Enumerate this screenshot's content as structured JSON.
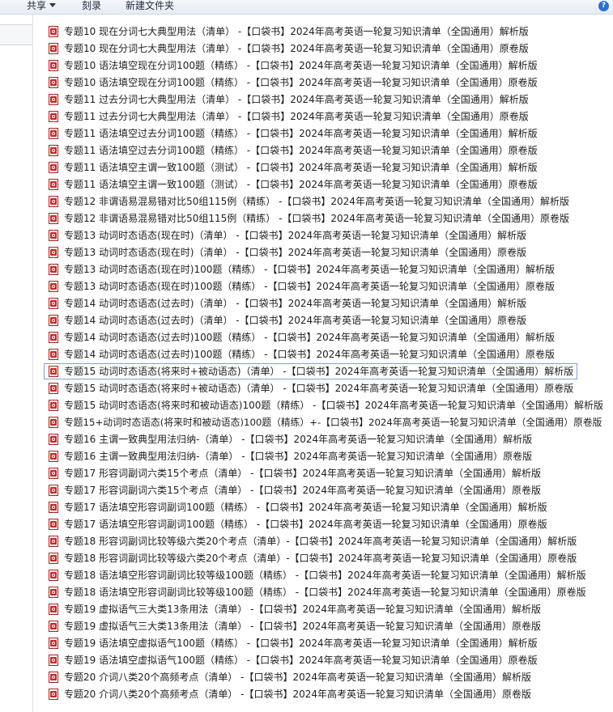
{
  "toolbar": {
    "share_label": "共享",
    "burn_label": "刻录",
    "new_folder_label": "新建文件夹",
    "help_icon": "help-icon"
  },
  "files": [
    "专题10 现在分词七大典型用法（清单） -【口袋书】2024年高考英语一轮复习知识清单（全国通用）解析版",
    "专题10 现在分词七大典型用法（清单） -【口袋书】2024年高考英语一轮复习知识清单（全国通用）原卷版",
    "专题10 语法填空现在分词100题（精练） -【口袋书】2024年高考英语一轮复习知识清单（全国通用）解析版",
    "专题10 语法填空现在分词100题（精练） -【口袋书】2024年高考英语一轮复习知识清单（全国通用）原卷版",
    "专题11 过去分词七大典型用法（清单） -【口袋书】2024年高考英语一轮复习知识清单（全国通用）解析版",
    "专题11 过去分词七大典型用法（清单） -【口袋书】2024年高考英语一轮复习知识清单（全国通用）原卷版",
    "专题11 语法填空过去分词100题（精练） -【口袋书】2024年高考英语一轮复习知识清单（全国通用）解析版",
    "专题11 语法填空过去分词100题（精练） -【口袋书】2024年高考英语一轮复习知识清单（全国通用）原卷版",
    "专题11 语法填空主谓一致100题（测试） -【口袋书】2024年高考英语一轮复习知识清单（全国通用）解析版",
    "专题11 语法填空主谓一致100题（测试） -【口袋书】2024年高考英语一轮复习知识清单（全国通用）原卷版",
    "专题12 非谓语易混易错对比50组115例（精练） -【口袋书】2024年高考英语一轮复习知识清单（全国通用）解析版",
    "专题12 非谓语易混易错对比50组115例（精练） -【口袋书】2024年高考英语一轮复习知识清单（全国通用）原卷版",
    "专题13 动词时态语态(现在时)（清单） -【口袋书】2024年高考英语一轮复习知识清单（全国通用）解析版",
    "专题13 动词时态语态(现在时)（清单） -【口袋书】2024年高考英语一轮复习知识清单（全国通用）原卷版",
    "专题13 动词时态语态(现在时)100题（精练） -【口袋书】2024年高考英语一轮复习知识清单（全国通用）解析版",
    "专题13 动词时态语态(现在时)100题（精练） -【口袋书】2024年高考英语一轮复习知识清单（全国通用）原卷版",
    "专题14 动词时态语态(过去时)（清单） -【口袋书】2024年高考英语一轮复习知识清单（全国通用）解析版",
    "专题14 动词时态语态(过去时)（清单） -【口袋书】2024年高考英语一轮复习知识清单（全国通用）原卷版",
    "专题14 动词时态语态(过去时)100题（精练） -【口袋书】2024年高考英语一轮复习知识清单（全国通用）解析版",
    "专题14 动词时态语态(过去时)100题（精练） -【口袋书】2024年高考英语一轮复习知识清单（全国通用）原卷版",
    "专题15 动词时态语态(将来时+被动语态)（清单） -【口袋书】2024年高考英语一轮复习知识清单（全国通用）解析版",
    "专题15 动词时态语态(将来时+被动语态)（清单） -【口袋书】2024年高考英语一轮复习知识清单（全国通用）原卷版",
    "专题15 动词时态语态(将来时和被动语态)100题（精练） -【口袋书】2024年高考英语一轮复习知识清单（全国通用）解析版",
    "专题15+动词时态语态(将来时和被动语态)100题（精练）+-【口袋书】2024年高考英语一轮复习知识清单（全国通用）原卷版",
    "专题16 主谓一致典型用法归纳-（清单） -【口袋书】2024年高考英语一轮复习知识清单（全国通用）解析版",
    "专题16 主谓一致典型用法归纳-（清单） -【口袋书】2024年高考英语一轮复习知识清单（全国通用）原卷版",
    "专题17 形容词副词六类15个考点（清单） -【口袋书】2024年高考英语一轮复习知识清单（全国通用）解析版",
    "专题17 形容词副词六类15个考点（清单） -【口袋书】2024年高考英语一轮复习知识清单（全国通用）原卷版",
    "专题17 语法填空形容词副词100题（精练） -【口袋书】2024年高考英语一轮复习知识清单（全国通用）解析版",
    "专题17 语法填空形容词副词100题（精练） -【口袋书】2024年高考英语一轮复习知识清单（全国通用）原卷版",
    "专题18 形容词副词比较等级六类20个考点（清单）-【口袋书】2024年高考英语一轮复习知识清单（全国通用）解析版",
    "专题18 形容词副词比较等级六类20个考点（清单）-【口袋书】2024年高考英语一轮复习知识清单（全国通用）原卷版",
    "专题18 语法填空形容词副词比较等级100题（精练） -【口袋书】2024年高考英语一轮复习知识清单（全国通用）解析版",
    "专题18 语法填空形容词副词比较等级100题（精练） -【口袋书】2024年高考英语一轮复习知识清单（全国通用）原卷版",
    "专题19 虚拟语气三大类13条用法（清单） -【口袋书】2024年高考英语一轮复习知识清单（全国通用）解析版",
    "专题19 虚拟语气三大类13条用法（清单） -【口袋书】2024年高考英语一轮复习知识清单（全国通用）原卷版",
    "专题19 语法填空虚拟语气100题（精练） -【口袋书】2024年高考英语一轮复习知识清单（全国通用）解析版",
    "专题19 语法填空虚拟语气100题（精练） -【口袋书】2024年高考英语一轮复习知识清单（全国通用）原卷版",
    "专题20 介词八类20个高频考点（清单） -【口袋书】2024年高考英语一轮复习知识清单（全国通用）解析版",
    "专题20 介词八类20个高频考点（清单） -【口袋书】2024年高考英语一轮复习知识清单（全国通用）原卷版"
  ],
  "selected_index": 20,
  "colors": {
    "pdf_red": "#c62828",
    "selection_border": "#7da2ce"
  }
}
